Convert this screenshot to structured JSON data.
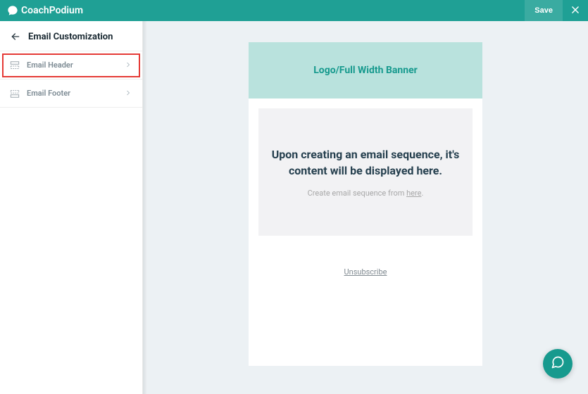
{
  "brand": {
    "name": "CoachPodium"
  },
  "topbar": {
    "save_label": "Save"
  },
  "sidebar": {
    "title": "Email Customization",
    "items": [
      {
        "label": "Email Header",
        "highlighted": true
      },
      {
        "label": "Email Footer",
        "highlighted": false
      }
    ]
  },
  "preview": {
    "banner_text": "Logo/Full Width Banner",
    "body_heading": "Upon creating an email sequence, it's content will be displayed here.",
    "body_sub_prefix": "Create email sequence from ",
    "body_sub_link": "here",
    "body_sub_suffix": ".",
    "unsubscribe_label": "Unsubscribe"
  }
}
